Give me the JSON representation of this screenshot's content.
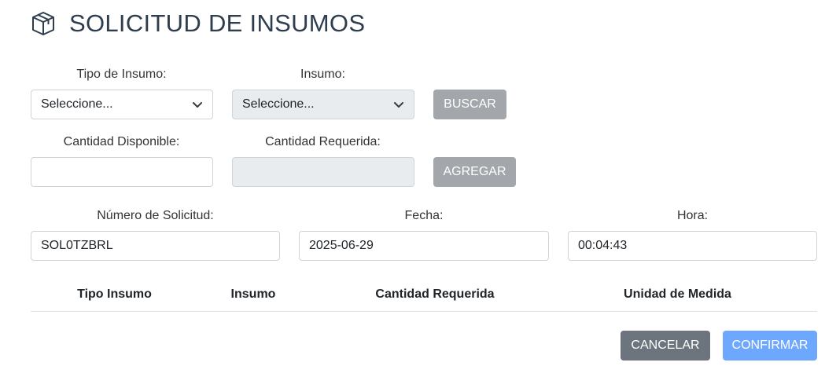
{
  "header": {
    "title": "SOLICITUD DE INSUMOS",
    "icon": "box-icon"
  },
  "form": {
    "tipo_insumo": {
      "label": "Tipo de Insumo:",
      "value": "Seleccione..."
    },
    "insumo": {
      "label": "Insumo:",
      "value": "Seleccione..."
    },
    "buscar_label": "BUSCAR",
    "cantidad_disponible": {
      "label": "Cantidad Disponible:",
      "value": ""
    },
    "cantidad_requerida": {
      "label": "Cantidad Requerida:",
      "value": ""
    },
    "agregar_label": "AGREGAR",
    "numero_solicitud": {
      "label": "Número de Solicitud:",
      "value": "SOL0TZBRL"
    },
    "fecha": {
      "label": "Fecha:",
      "value": "2025-06-29"
    },
    "hora": {
      "label": "Hora:",
      "value": "00:04:43"
    }
  },
  "table": {
    "columns": [
      "Tipo Insumo",
      "Insumo",
      "Cantidad Requerida",
      "Unidad de Medida"
    ]
  },
  "actions": {
    "cancel_label": "CANCELAR",
    "confirm_label": "CONFIRMAR"
  },
  "colors": {
    "title": "#2f3e4e",
    "disabled_button": "#a3a6ab",
    "cancel": "#6c757d",
    "confirm": "#6ea8fe"
  }
}
